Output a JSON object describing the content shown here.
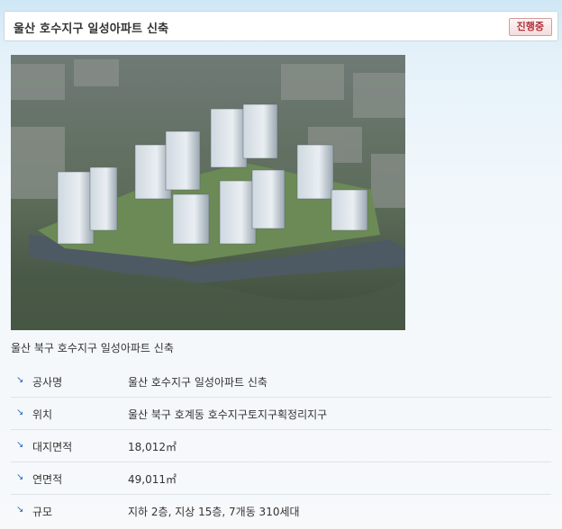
{
  "header": {
    "title": "울산 호수지구 일성아파트 신축",
    "status": "진행중"
  },
  "photo": {
    "caption": "울산 북구 호수지구 일성아파트 신축"
  },
  "info": [
    {
      "label": "공사명",
      "value": "울산 호수지구 일성아파트 신축"
    },
    {
      "label": "위치",
      "value": "울산 북구 호계동 호수지구토지구획정리지구"
    },
    {
      "label": "대지면적",
      "value": "18,012㎡"
    },
    {
      "label": "연면적",
      "value": "49,011㎡"
    },
    {
      "label": "규모",
      "value": "지하 2층, 지상 15층, 7개동 310세대"
    }
  ],
  "colors": {
    "accent": "#2a63b8",
    "status": "#b0303a"
  }
}
